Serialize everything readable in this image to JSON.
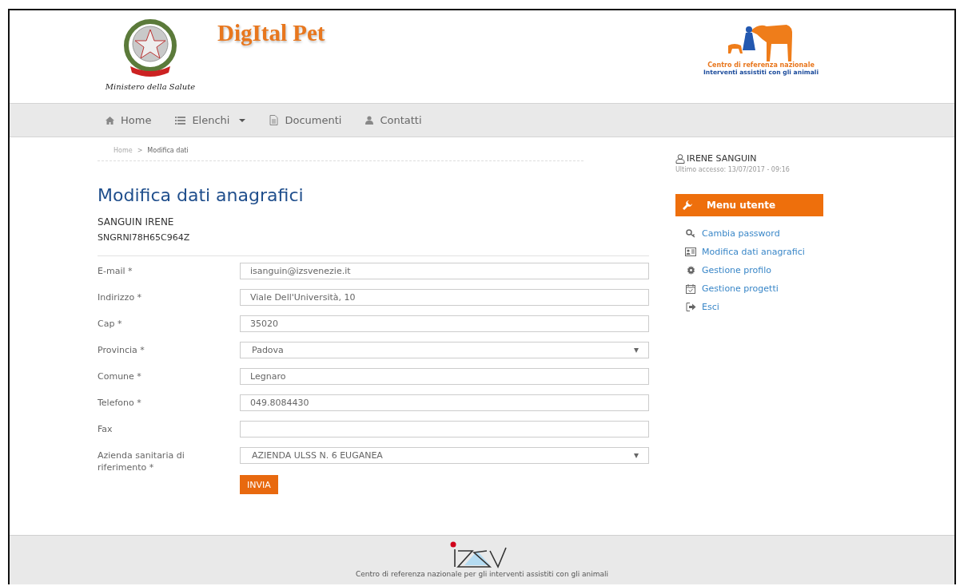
{
  "header": {
    "ministry_caption": "Ministero della Salute",
    "title": "DigItal Pet",
    "partner_logo": {
      "line_1": "Centro di referenza nazionale",
      "line_2": "Interventi assistiti con gli animali"
    }
  },
  "nav": [
    {
      "label": "Home",
      "dropdown": false
    },
    {
      "label": "Elenchi",
      "dropdown": true
    },
    {
      "label": "Documenti",
      "dropdown": false
    },
    {
      "label": "Contatti",
      "dropdown": false
    }
  ],
  "breadcrumb": {
    "items": [
      "Home",
      "Modifica dati"
    ],
    "separator": ">"
  },
  "page_title": "Modifica dati anagrafici",
  "person": {
    "name": "SANGUIN IRENE",
    "code": "SNGRNI78H65C964Z"
  },
  "form": {
    "fields": [
      {
        "label": "E-mail *",
        "kind": "text",
        "value": "isanguin@izsvenezie.it"
      },
      {
        "label": "Indirizzo *",
        "kind": "text",
        "value": "Viale Dell'Università, 10"
      },
      {
        "label": "Cap *",
        "kind": "text",
        "value": "35020"
      },
      {
        "label": "Provincia *",
        "kind": "select",
        "value": "Padova"
      },
      {
        "label": "Comune *",
        "kind": "text",
        "value": "Legnaro"
      },
      {
        "label": "Telefono *",
        "kind": "text",
        "value": "049.8084430"
      },
      {
        "label": "Fax",
        "kind": "text"
      },
      {
        "label": "Azienda sanitaria di riferimento *",
        "kind": "select",
        "value": "AZIENDA ULSS N. 6 EUGANEA"
      }
    ],
    "submit": "INVIA"
  },
  "user": {
    "name": "IRENE SANGUIN",
    "last_access": "Ultimo accesso: 13/07/2017 - 09:16"
  },
  "user_menu": {
    "title": "Menu utente",
    "items": [
      {
        "label": "Cambia password"
      },
      {
        "label": "Modifica dati anagrafici"
      },
      {
        "label": "Gestione profilo"
      },
      {
        "label": "Gestione progetti"
      },
      {
        "label": "Esci"
      }
    ]
  },
  "footer": {
    "caption": "Centro di referenza nazionale per gli interventi assistiti con gli animali"
  }
}
